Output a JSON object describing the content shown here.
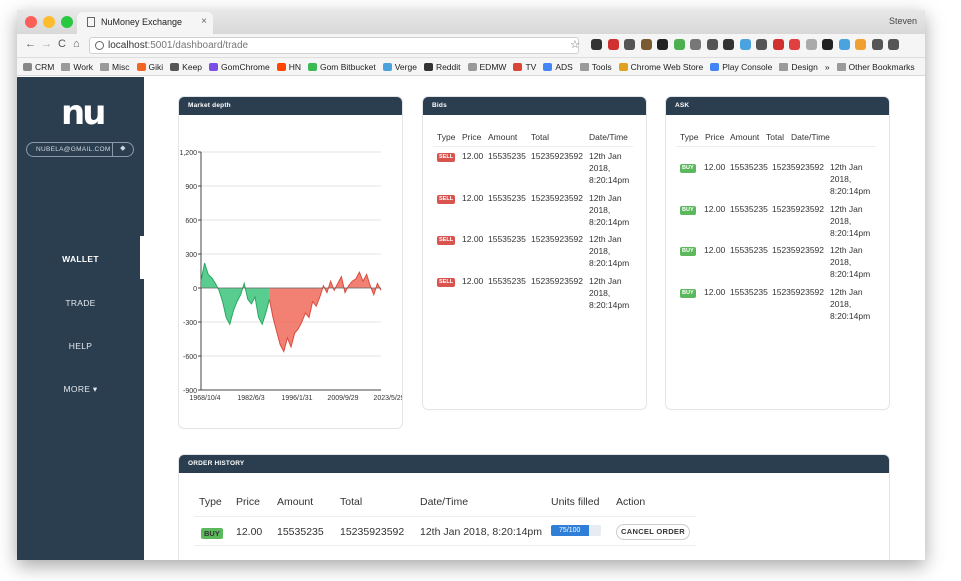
{
  "browser": {
    "tab_title": "NuMoney Exchange",
    "tab_close": "×",
    "user": "Steven",
    "url_host": "localhost",
    "url_rest": ":5001/dashboard/trade",
    "nav_back": "←",
    "nav_forward": "→",
    "nav_reload": "C",
    "nav_home": "⌂",
    "star": "☆",
    "bookmarks": [
      "CRM",
      "Work",
      "Misc",
      "Giki",
      "Keep",
      "GomChrome",
      "HN",
      "Gom Bitbucket",
      "Verge",
      "Reddit",
      "EDMW",
      "TV",
      "ADS",
      "Tools",
      "Chrome Web Store",
      "Play Console",
      "Design"
    ],
    "bookmarks_more": "»",
    "other_bookmarks": "Other Bookmarks"
  },
  "sidebar": {
    "logo": "nu",
    "email": "NUBELA@GMAIL.COM",
    "bell": "🔔",
    "items": [
      {
        "label": "WALLET"
      },
      {
        "label": "TRADE"
      },
      {
        "label": "HELP"
      },
      {
        "label": "MORE ▾"
      }
    ]
  },
  "market_depth": {
    "title": "Market depth"
  },
  "bids": {
    "title": "Bids",
    "columns": [
      "Type",
      "Price",
      "Amount",
      "Total",
      "Date/Time"
    ],
    "rows": [
      {
        "type": "SELL",
        "price": "12.00",
        "amount": "15535235",
        "total": "15235923592",
        "date1": "12th Jan",
        "date2": "2018,",
        "date3": "8:20:14pm"
      },
      {
        "type": "SELL",
        "price": "12.00",
        "amount": "15535235",
        "total": "15235923592",
        "date1": "12th Jan",
        "date2": "2018,",
        "date3": "8:20:14pm"
      },
      {
        "type": "SELL",
        "price": "12.00",
        "amount": "15535235",
        "total": "15235923592",
        "date1": "12th Jan",
        "date2": "2018,",
        "date3": "8:20:14pm"
      },
      {
        "type": "SELL",
        "price": "12.00",
        "amount": "15535235",
        "total": "15235923592",
        "date1": "12th Jan",
        "date2": "2018,",
        "date3": "8:20:14pm"
      }
    ]
  },
  "ask": {
    "title": "ASK",
    "columns": [
      "Type",
      "Price",
      "Amount",
      "Total",
      "Date/Time"
    ],
    "rows": [
      {
        "type": "BUY",
        "price": "12.00",
        "amount": "15535235",
        "total": "15235923592",
        "date1": "12th Jan",
        "date2": "2018,",
        "date3": "8:20:14pm"
      },
      {
        "type": "BUY",
        "price": "12.00",
        "amount": "15535235",
        "total": "15235923592",
        "date1": "12th Jan",
        "date2": "2018,",
        "date3": "8:20:14pm"
      },
      {
        "type": "BUY",
        "price": "12.00",
        "amount": "15535235",
        "total": "15235923592",
        "date1": "12th Jan",
        "date2": "2018,",
        "date3": "8:20:14pm"
      },
      {
        "type": "BUY",
        "price": "12.00",
        "amount": "15535235",
        "total": "15235923592",
        "date1": "12th Jan",
        "date2": "2018,",
        "date3": "8:20:14pm"
      }
    ]
  },
  "order_history": {
    "title": "ORDER HISTORY",
    "columns": [
      "Type",
      "Price",
      "Amount",
      "Total",
      "Date/Time",
      "Units filled",
      "Action"
    ],
    "rows": [
      {
        "type": "BUY",
        "price": "12.00",
        "amount": "15535235",
        "total": "15235923592",
        "datetime": "12th Jan 2018, 8:20:14pm",
        "filled_label": "75/100",
        "filled_fraction": 0.75,
        "action": "CANCEL ORDER"
      }
    ]
  },
  "colors": {
    "sidebar": "#2b3e50",
    "positive": "#3cc47c",
    "negative": "#f06b5c",
    "progress": "#2f7ed8"
  },
  "chart_data": {
    "type": "area",
    "title": "",
    "xlabel": "",
    "ylabel": "",
    "ylim": [
      -900,
      1200
    ],
    "yticks": [
      "1,200",
      "900",
      "600",
      "300",
      "0",
      "-300",
      "-600",
      "-900"
    ],
    "ytick_values": [
      1200,
      900,
      600,
      300,
      0,
      -300,
      -600,
      -900
    ],
    "xticks": [
      "1968/10/4",
      "1982/6/3",
      "1996/1/31",
      "2009/9/29",
      "2023/5/29"
    ],
    "grid": true,
    "series": [
      {
        "color_pos": "#3cc47c",
        "color_neg": "#f06b5c",
        "x": [
          0,
          2,
          4,
          6,
          8,
          10,
          12,
          14,
          16,
          18,
          20,
          22,
          24,
          26,
          28,
          30,
          32,
          34,
          36,
          38,
          40,
          42,
          44,
          46,
          48,
          50,
          52,
          54,
          56,
          58,
          60,
          62,
          64,
          66,
          68,
          70,
          72,
          74,
          76,
          78,
          80,
          82,
          84,
          86,
          88,
          90,
          92,
          94,
          96,
          98,
          100
        ],
        "values": [
          60,
          220,
          120,
          90,
          40,
          -20,
          -120,
          -260,
          -320,
          -200,
          -120,
          -60,
          40,
          -100,
          -140,
          -80,
          -260,
          -320,
          -220,
          -100,
          -260,
          -380,
          -500,
          -560,
          -440,
          -520,
          -400,
          -360,
          -300,
          -220,
          -260,
          -120,
          -160,
          -80,
          20,
          -40,
          60,
          -20,
          40,
          100,
          -40,
          20,
          60,
          80,
          140,
          60,
          120,
          20,
          -60,
          40,
          -20
        ]
      }
    ]
  }
}
